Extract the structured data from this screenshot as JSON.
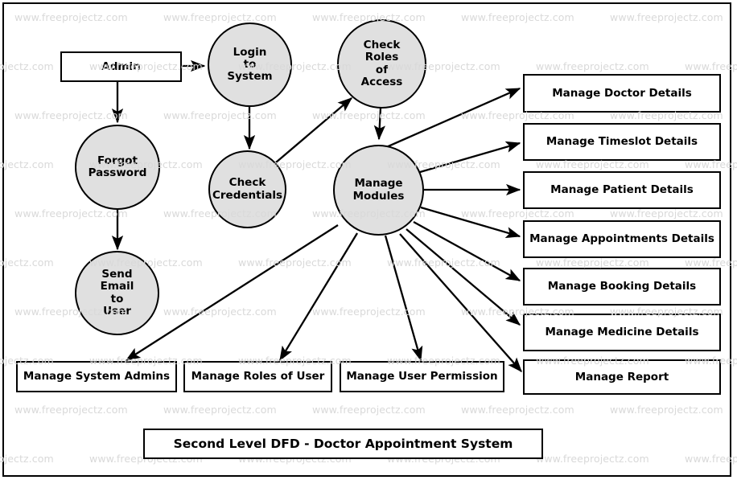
{
  "diagram": {
    "title": "Second Level DFD - Doctor Appointment System",
    "watermark_text": "www.freeprojectz.com",
    "background_color": "#ffffff",
    "border_color": "#000000",
    "process_fill_color": "#e0e0e0",
    "entity_fill_color": "#ffffff",
    "watermark_color": "#d9d9d9"
  },
  "processes": [
    {
      "id": "login_to_system",
      "label": "Login to System",
      "lines": [
        "Login",
        "to",
        "System"
      ]
    },
    {
      "id": "check_roles",
      "label": "Check Roles of Access",
      "lines": [
        "Check",
        "Roles",
        "of",
        "Access"
      ]
    },
    {
      "id": "forgot_password",
      "label": "Forgot Password",
      "lines": [
        "Forgot",
        "Password"
      ]
    },
    {
      "id": "check_credentials",
      "label": "Check Credentials",
      "lines": [
        "Check",
        "Credentials"
      ]
    },
    {
      "id": "send_email",
      "label": "Send Email to User",
      "lines": [
        "Send",
        "Email",
        "to",
        "User"
      ]
    },
    {
      "id": "manage_modules",
      "label": "Manage Modules",
      "lines": [
        "Manage",
        "Modules"
      ]
    }
  ],
  "entities": [
    {
      "id": "admin",
      "label": "Admin"
    },
    {
      "id": "manage_doctor",
      "label": "Manage Doctor Details"
    },
    {
      "id": "manage_timeslot",
      "label": "Manage Timeslot Details"
    },
    {
      "id": "manage_patient",
      "label": "Manage Patient Details"
    },
    {
      "id": "manage_appointments",
      "label": "Manage Appointments Details"
    },
    {
      "id": "manage_booking",
      "label": "Manage Booking Details"
    },
    {
      "id": "manage_medicine",
      "label": "Manage Medicine Details"
    },
    {
      "id": "manage_report",
      "label": "Manage Report"
    },
    {
      "id": "manage_system_admins",
      "label": "Manage System Admins"
    },
    {
      "id": "manage_roles_of_user",
      "label": "Manage Roles of User"
    },
    {
      "id": "manage_user_permission",
      "label": "Manage User Permission"
    }
  ],
  "flows": [
    {
      "from": "admin",
      "to": "login_to_system"
    },
    {
      "from": "admin",
      "to": "forgot_password"
    },
    {
      "from": "forgot_password",
      "to": "send_email"
    },
    {
      "from": "login_to_system",
      "to": "check_credentials"
    },
    {
      "from": "check_credentials",
      "to": "check_roles"
    },
    {
      "from": "check_roles",
      "to": "manage_modules"
    },
    {
      "from": "manage_modules",
      "to": "manage_doctor"
    },
    {
      "from": "manage_modules",
      "to": "manage_timeslot"
    },
    {
      "from": "manage_modules",
      "to": "manage_patient"
    },
    {
      "from": "manage_modules",
      "to": "manage_appointments"
    },
    {
      "from": "manage_modules",
      "to": "manage_booking"
    },
    {
      "from": "manage_modules",
      "to": "manage_medicine"
    },
    {
      "from": "manage_modules",
      "to": "manage_report"
    },
    {
      "from": "manage_modules",
      "to": "manage_system_admins"
    },
    {
      "from": "manage_modules",
      "to": "manage_roles_of_user"
    },
    {
      "from": "manage_modules",
      "to": "manage_user_permission"
    }
  ]
}
